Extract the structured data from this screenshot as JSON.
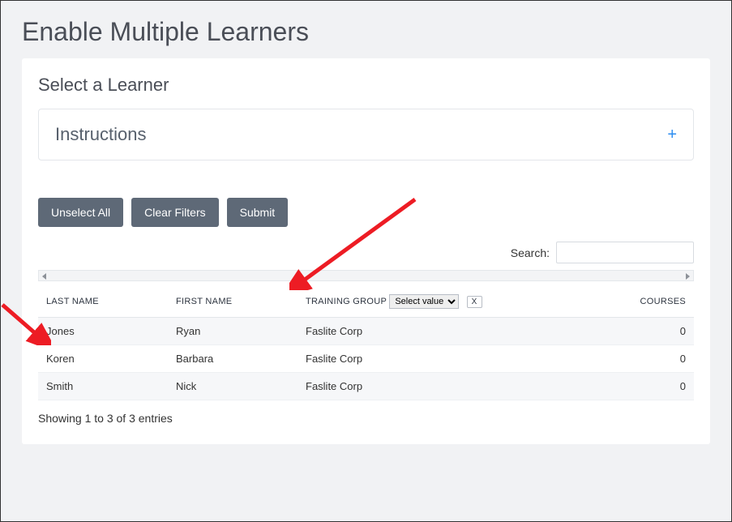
{
  "page": {
    "title": "Enable Multiple Learners",
    "section_title": "Select a Learner"
  },
  "instructions": {
    "title": "Instructions"
  },
  "buttons": {
    "unselect_all": "Unselect All",
    "clear_filters": "Clear Filters",
    "submit": "Submit"
  },
  "search": {
    "label": "Search:",
    "value": ""
  },
  "table": {
    "headers": {
      "last_name": "LAST NAME",
      "first_name": "FIRST NAME",
      "training_group": "TRAINING GROUP",
      "courses": "COURSES"
    },
    "training_group_filter": {
      "placeholder": "Select value",
      "clear_label": "X"
    },
    "rows": [
      {
        "last_name": "Jones",
        "first_name": "Ryan",
        "training_group": "Faslite Corp",
        "courses": "0"
      },
      {
        "last_name": "Koren",
        "first_name": "Barbara",
        "training_group": "Faslite Corp",
        "courses": "0"
      },
      {
        "last_name": "Smith",
        "first_name": "Nick",
        "training_group": "Faslite Corp",
        "courses": "0"
      }
    ],
    "footer": "Showing 1 to 3 of 3 entries"
  }
}
